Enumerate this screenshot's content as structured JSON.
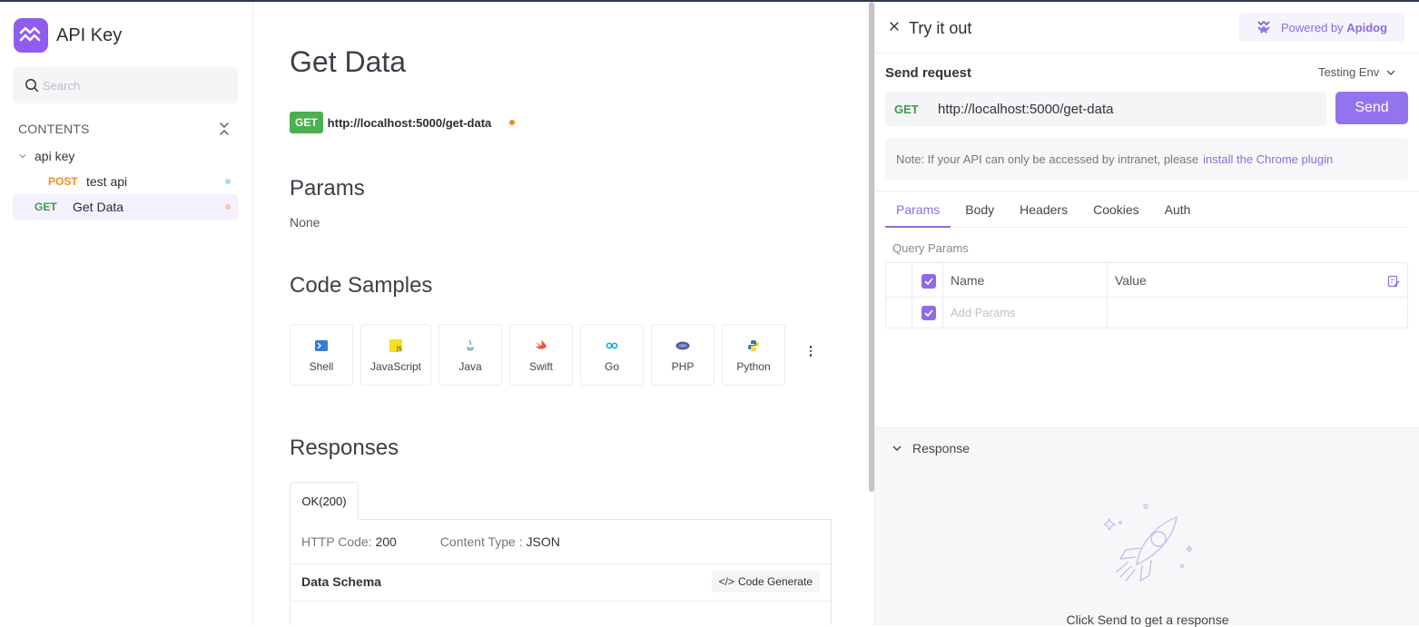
{
  "sidebar": {
    "title": "API Key",
    "search_placeholder": "Search",
    "contents_label": "CONTENTS",
    "folder": "api key",
    "items": [
      {
        "method": "POST",
        "label": "test api",
        "dot_color": "#a8d8f0"
      },
      {
        "method": "GET",
        "label": "Get Data",
        "dot_color": "#f6c9a8"
      }
    ]
  },
  "main": {
    "title": "Get Data",
    "method": "GET",
    "url": "http://localhost:5000/get-data",
    "params_heading": "Params",
    "params_value": "None",
    "code_samples_heading": "Code Samples",
    "languages": [
      "Shell",
      "JavaScript",
      "Java",
      "Swift",
      "Go",
      "PHP",
      "Python"
    ],
    "responses_heading": "Responses",
    "response_tab": "OK(200)",
    "http_code_label": "HTTP Code:",
    "http_code": "200",
    "content_type_label": "Content Type :",
    "content_type": "JSON",
    "data_schema_label": "Data Schema",
    "code_generate_label": "Code Generate"
  },
  "panel": {
    "title": "Try it out",
    "powered_prefix": "Powered by",
    "powered_brand": "Apidog",
    "send_request_label": "Send request",
    "env": "Testing Env",
    "method": "GET",
    "url": "http://localhost:5000/get-data",
    "send_label": "Send",
    "note_text": "Note: If your API can only be accessed by intranet, please",
    "note_link": "install the Chrome plugin",
    "tabs": [
      "Params",
      "Body",
      "Headers",
      "Cookies",
      "Auth"
    ],
    "active_tab": "Params",
    "query_params_label": "Query Params",
    "col_name": "Name",
    "col_value": "Value",
    "add_params_placeholder": "Add Params",
    "response_label": "Response",
    "response_hint": "Click Send to get a response"
  },
  "colors": {
    "accent": "#8b6ce8",
    "get": "#3b9f48",
    "post": "#f28c28"
  }
}
